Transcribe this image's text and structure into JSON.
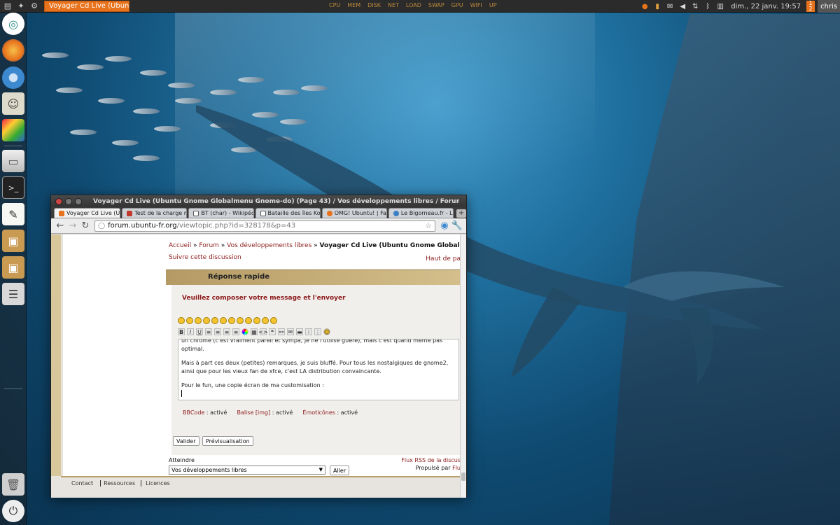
{
  "top_panel": {
    "task_title": "Voyager Cd Live (Ubuntu G…",
    "center_indicators": [
      "CPU",
      "MEM",
      "DISK",
      "NET",
      "LOAD",
      "SWAP",
      "GPU",
      "WIFI",
      "UP"
    ],
    "clock": "dim., 22 janv. 19:57",
    "notification_count": "1\n2",
    "user": "chris"
  },
  "launcher": {
    "items": [
      {
        "icon": "ubuntu-one-icon"
      },
      {
        "icon": "firefox-icon"
      },
      {
        "icon": "chromium-icon"
      },
      {
        "icon": "mail-stamp-icon"
      },
      {
        "icon": "paint-icon"
      },
      {
        "icon": "file-manager-icon"
      },
      {
        "icon": "terminal-icon"
      },
      {
        "icon": "text-editor-icon"
      },
      {
        "icon": "package-installer-icon"
      },
      {
        "icon": "package-manager-icon"
      },
      {
        "icon": "mixer-settings-icon"
      },
      {
        "icon": "trash-icon"
      },
      {
        "icon": "shutdown-icon"
      }
    ]
  },
  "window": {
    "title": "Voyager Cd Live (Ubuntu Gnome Globalmenu Gnome-do) (Page 43) / Vos développements libres / Forum Ubuntu-fr.org - Chromium",
    "tabs": [
      {
        "label": "Voyager Cd Live (U",
        "color": "#e8731c"
      },
      {
        "label": "Test de la charge m",
        "color": "#c0392b"
      },
      {
        "label": "BT (char) - Wikipédi",
        "color": "#555555"
      },
      {
        "label": "Bataille des îles Kor",
        "color": "#555555"
      },
      {
        "label": "OMG! Ubuntu! | Fa",
        "color": "#e8731c"
      },
      {
        "label": "Le Bigorneau.fr - L",
        "color": "#3b7fc4"
      }
    ],
    "url_host": "forum.ubuntu-fr.org",
    "url_path": "/viewtopic.php?id=328178&p=43"
  },
  "page": {
    "breadcrumb": {
      "home": "Accueil",
      "forum": "Forum",
      "section": "Vos développements libres",
      "current": "Voyager Cd Live (Ubuntu Gnome Globalmenu Gnome-d"
    },
    "follow_link": "Suivre cette discussion",
    "top_link": "Haut de pa",
    "quick_reply_title": "Réponse rapide",
    "compose_prompt": "Veuillez composer votre message et l'envoyer",
    "editor_lines": [
      "un chromé (c'est vraiment pareil et sympa, je ne l'utilise guère), mais c'est quand même pas",
      "optimal.",
      "Mais à part ces deux (petites) remarques, je suis bluffé. Pour tous les nostalgiques de gnome2,",
      "ainsi que pour les vieux fan de xfce, c'est LA distribution convaincante.",
      "Pour le fun, une copie écran de ma customisation :"
    ],
    "bbcode_label": "BBCode",
    "bbcode_state": ": activé",
    "img_label": "Balise [img]",
    "img_state": ": activé",
    "emoticon_label": "Émoticônes",
    "emoticon_state": ": activé",
    "submit_label": "Valider",
    "preview_label": "Prévisualisation",
    "jump_label": "Atteindre",
    "jump_selected": "Vos développements libres",
    "go_label": "Aller",
    "rss_label": "Flux RSS de la discus",
    "powered_label": "Propulsé par",
    "powered_by": "Flu",
    "footer": {
      "contact": "Contact",
      "resources": "Ressources",
      "licences": "Licences"
    }
  }
}
